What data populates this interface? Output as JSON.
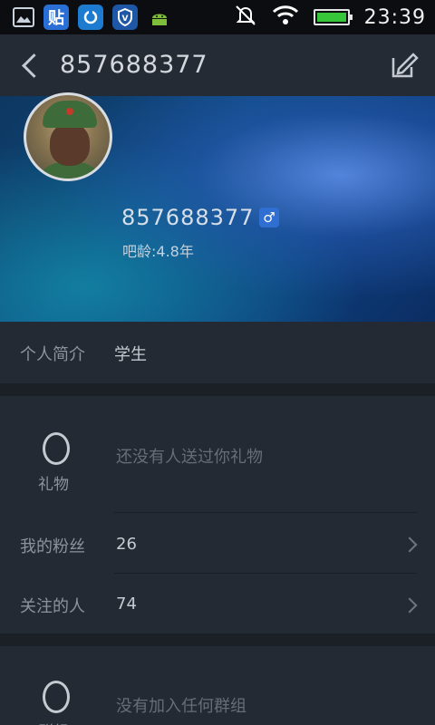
{
  "status": {
    "time": "23:39"
  },
  "header": {
    "title": "857688377"
  },
  "profile": {
    "username": "857688377",
    "gender_symbol": "♂",
    "bar_age": "吧龄:4.8年"
  },
  "intro": {
    "label": "个人简介",
    "value": "学生"
  },
  "gifts": {
    "count": "0",
    "label": "礼物",
    "empty_text": "还没有人送过你礼物"
  },
  "fans": {
    "label": "我的粉丝",
    "value": "26"
  },
  "following": {
    "label": "关注的人",
    "value": "74"
  },
  "groups": {
    "count": "0",
    "label": "群组",
    "empty_text": "没有加入任何群组"
  },
  "colors": {
    "accent": "#2f6fd1",
    "battery": "#37c53a"
  }
}
